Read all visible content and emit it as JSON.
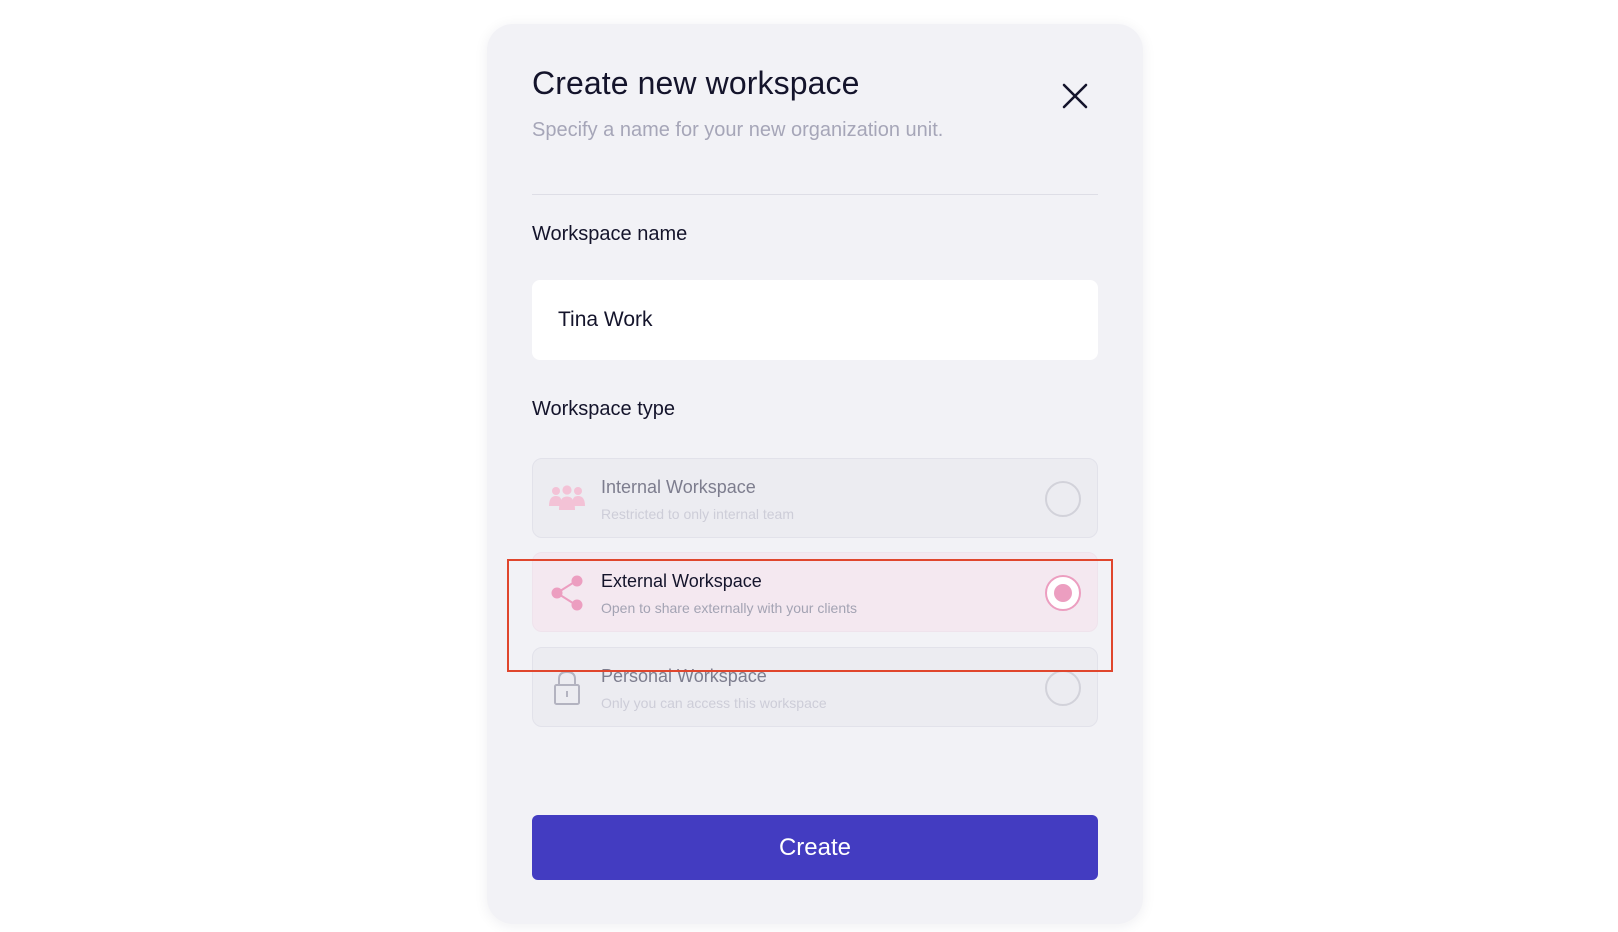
{
  "modal": {
    "title": "Create new workspace",
    "subtitle": "Specify a name for your new organization unit.",
    "close_icon": "close-icon"
  },
  "name_field": {
    "label": "Workspace name",
    "value": "Tina Work"
  },
  "type_field": {
    "label": "Workspace type",
    "options": [
      {
        "title": "Internal Workspace",
        "description": "Restricted to only internal team",
        "icon": "team-icon",
        "selected": false
      },
      {
        "title": "External Workspace",
        "description": "Open to share externally with your clients",
        "icon": "share-icon",
        "selected": true
      },
      {
        "title": "Personal Workspace",
        "description": "Only you can access this workspace",
        "icon": "lock-icon",
        "selected": false
      }
    ]
  },
  "actions": {
    "create_label": "Create"
  },
  "colors": {
    "primary": "#433cc1",
    "accent_pink": "#ec9ec0",
    "highlight": "#e0462d",
    "text_dark": "#14142b",
    "text_muted": "#a6a6b8"
  }
}
